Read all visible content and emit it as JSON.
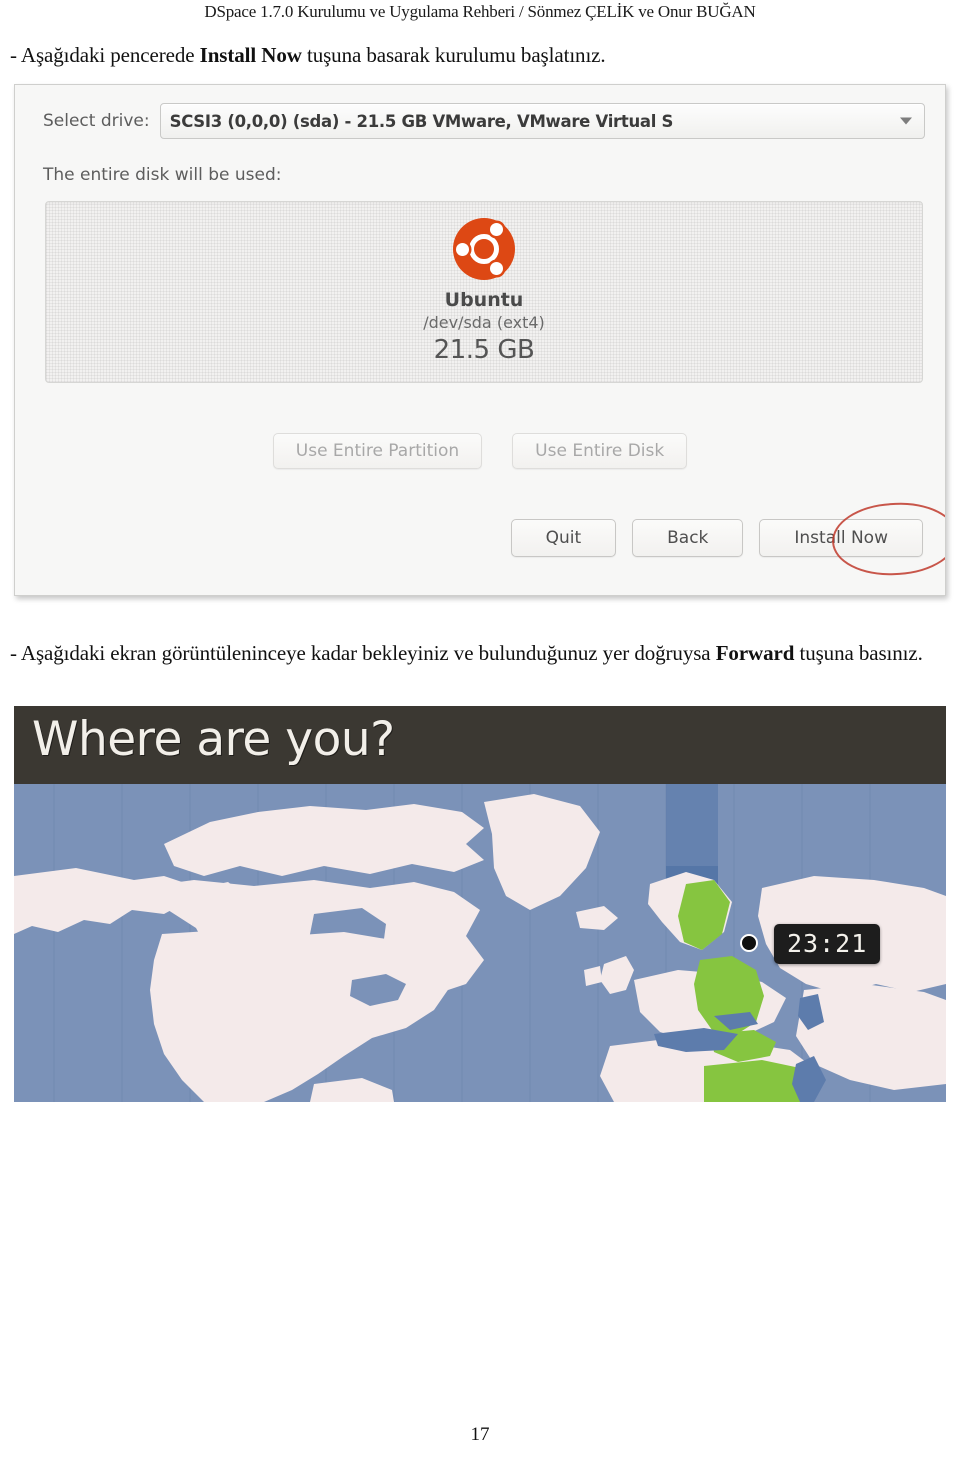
{
  "document": {
    "running_header": "DSpace 1.7.0  Kurulumu ve Uygulama Rehberi / Sönmez ÇELİK ve Onur BUĞAN",
    "page_number": "17"
  },
  "paragraphs": {
    "p1_before": "- Aşağıdaki pencerede ",
    "p1_bold": "Install Now",
    "p1_after": " tuşuna basarak kurulumu başlatınız.",
    "p2_before": "- Aşağıdaki ekran görüntüleninceye kadar bekleyiniz ve bulunduğunuz yer doğruysa ",
    "p2_bold": "Forward",
    "p2_after": " tuşuna basınız."
  },
  "installer": {
    "drive_label": "Select drive:",
    "drive_value": "SCSI3 (0,0,0) (sda) - 21.5 GB VMware, VMware Virtual S",
    "dropdown_icon": "chevron-down-icon",
    "disk_caption": "The entire disk will be used:",
    "disk": {
      "logo": "ubuntu-logo",
      "os_name": "Ubuntu",
      "device": "/dev/sda (ext4)",
      "size": "21.5 GB"
    },
    "partition_buttons": [
      {
        "label": "Use Entire Partition"
      },
      {
        "label": "Use Entire Disk"
      }
    ],
    "nav_buttons": [
      {
        "label": "Quit"
      },
      {
        "label": "Back"
      },
      {
        "label": "Install Now"
      }
    ],
    "annotation": "red-ellipse-around-install-now"
  },
  "location_screen": {
    "title": "Where are you?",
    "clock": "23:21",
    "marker": "location-marker",
    "colors": {
      "header_bg": "#3b3832",
      "ocean": "#7b92b8",
      "land": "#f4eaea",
      "highlight_timezone": "#86c540",
      "tooltip_bg": "#1d1d1d"
    }
  }
}
